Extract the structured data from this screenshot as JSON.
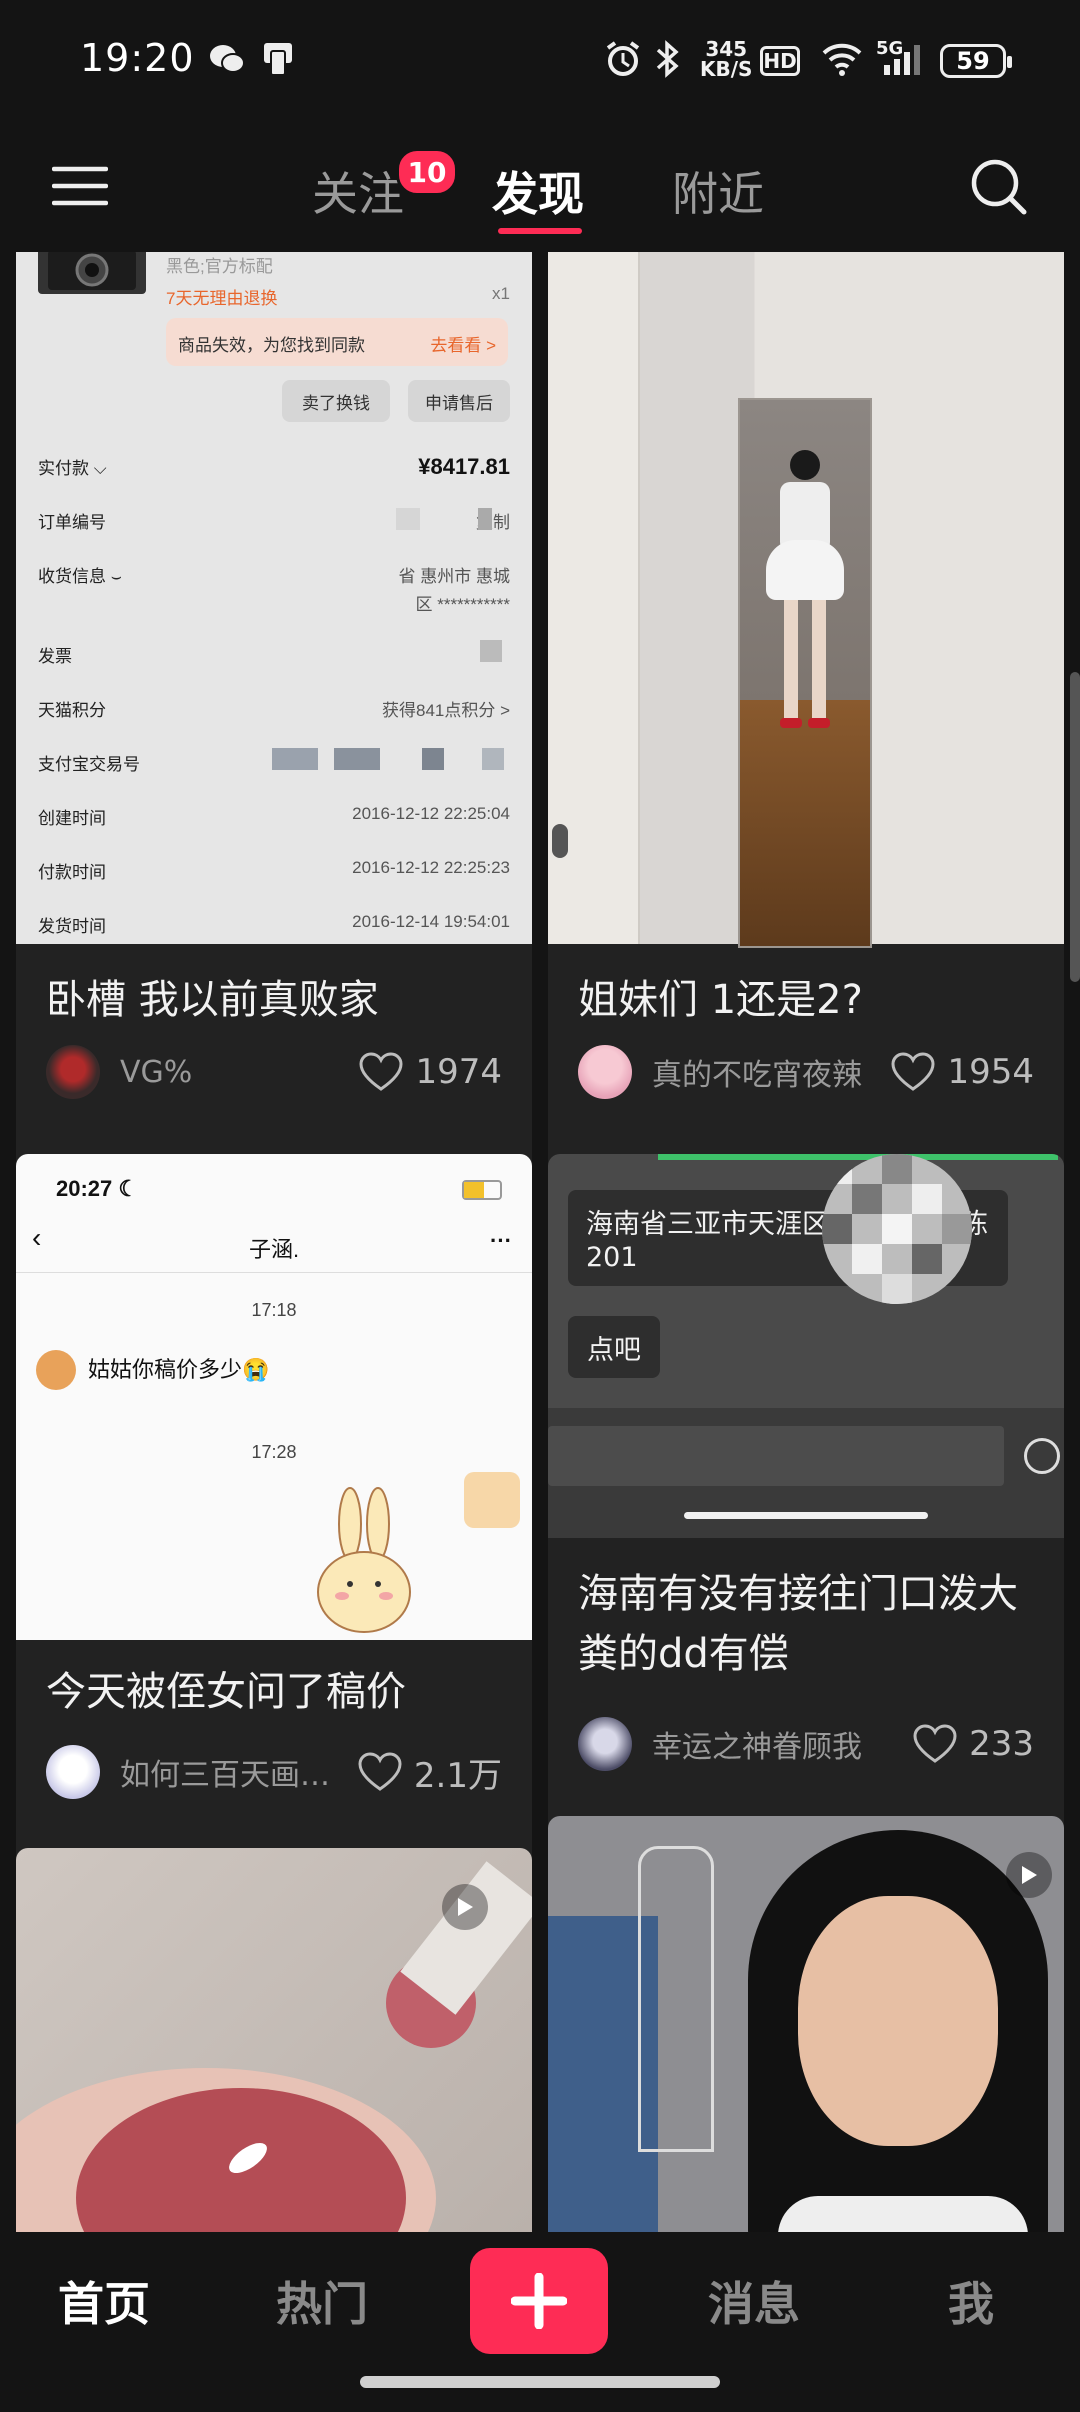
{
  "status_bar": {
    "time": "19:20",
    "net_speed_value": "345",
    "net_speed_unit": "KB/S",
    "hd_label": "HD",
    "network_label": "5G",
    "battery": "59"
  },
  "top_nav": {
    "tabs": [
      {
        "label": "关注",
        "badge": "10"
      },
      {
        "label": "发现"
      },
      {
        "label": "附近"
      }
    ],
    "active_tab": "发现"
  },
  "feed": [
    {
      "title": "卧槽 我以前真败家",
      "author": "VG%",
      "likes": "1974",
      "receipt": {
        "spec": "黑色;官方标配",
        "return_note": "7天无理由退换",
        "qty": "x1",
        "invalid_note": "商品失效，为您找到同款",
        "find_link": "去看看 >",
        "btn_sell": "卖了换钱",
        "btn_aftersale": "申请售后",
        "rows": [
          {
            "label": "实付款 ⌵",
            "value": "¥8417.81"
          },
          {
            "label": "订单编号",
            "value": "复制"
          },
          {
            "label": "收货信息 ⌣",
            "value": "省 惠州市 惠城"
          },
          {
            "label": "",
            "value": "区 ***********"
          },
          {
            "label": "发票",
            "value": ""
          },
          {
            "label": "天猫积分",
            "value": "获得841点积分 >"
          },
          {
            "label": "支付宝交易号",
            "value": ""
          },
          {
            "label": "创建时间",
            "value": "2016-12-12 22:25:04"
          },
          {
            "label": "付款时间",
            "value": "2016-12-12 22:25:23"
          },
          {
            "label": "发货时间",
            "value": "2016-12-14 19:54:01"
          }
        ]
      }
    },
    {
      "title": "姐妹们 1还是2?",
      "author": "真的不吃宵夜辣",
      "likes": "1954"
    },
    {
      "title": "今天被侄女问了稿价",
      "author": "如何三百天画…",
      "likes": "2.1万",
      "chat": {
        "time": "20:27",
        "contact": "子涵.",
        "stamp1": "17:18",
        "message": "姑姑你稿价多少😭",
        "stamp2": "17:28"
      }
    },
    {
      "title": "海南有没有接往门口泼大粪的dd有偿",
      "author": "幸运之神眷顾我",
      "likes": "233",
      "chat": {
        "address_line1": "海南省三亚市天涯区",
        "address_tail": "陈",
        "address_line2": "201",
        "reply": "点吧"
      }
    },
    {
      "title": "",
      "author": "",
      "likes": ""
    },
    {
      "title": "",
      "author": "",
      "likes": ""
    }
  ],
  "bottom_nav": {
    "items": [
      "首页",
      "热门",
      "消息",
      "我"
    ],
    "active": "首页"
  },
  "colors": {
    "accent": "#fe2c55",
    "background": "#141414",
    "card": "#222222"
  }
}
